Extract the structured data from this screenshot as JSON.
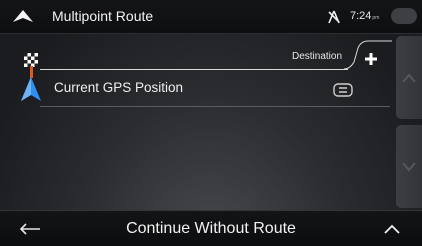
{
  "header": {
    "title": "Multipoint Route",
    "time": "7:24",
    "time_suffix": "pm"
  },
  "route": {
    "destination_label": "Destination",
    "points": [
      {
        "label": "Current GPS Position"
      }
    ]
  },
  "footer": {
    "continue_label": "Continue Without Route"
  },
  "colors": {
    "accent_blue": "#2f8ff0",
    "route_orange": "#e05a1c"
  }
}
